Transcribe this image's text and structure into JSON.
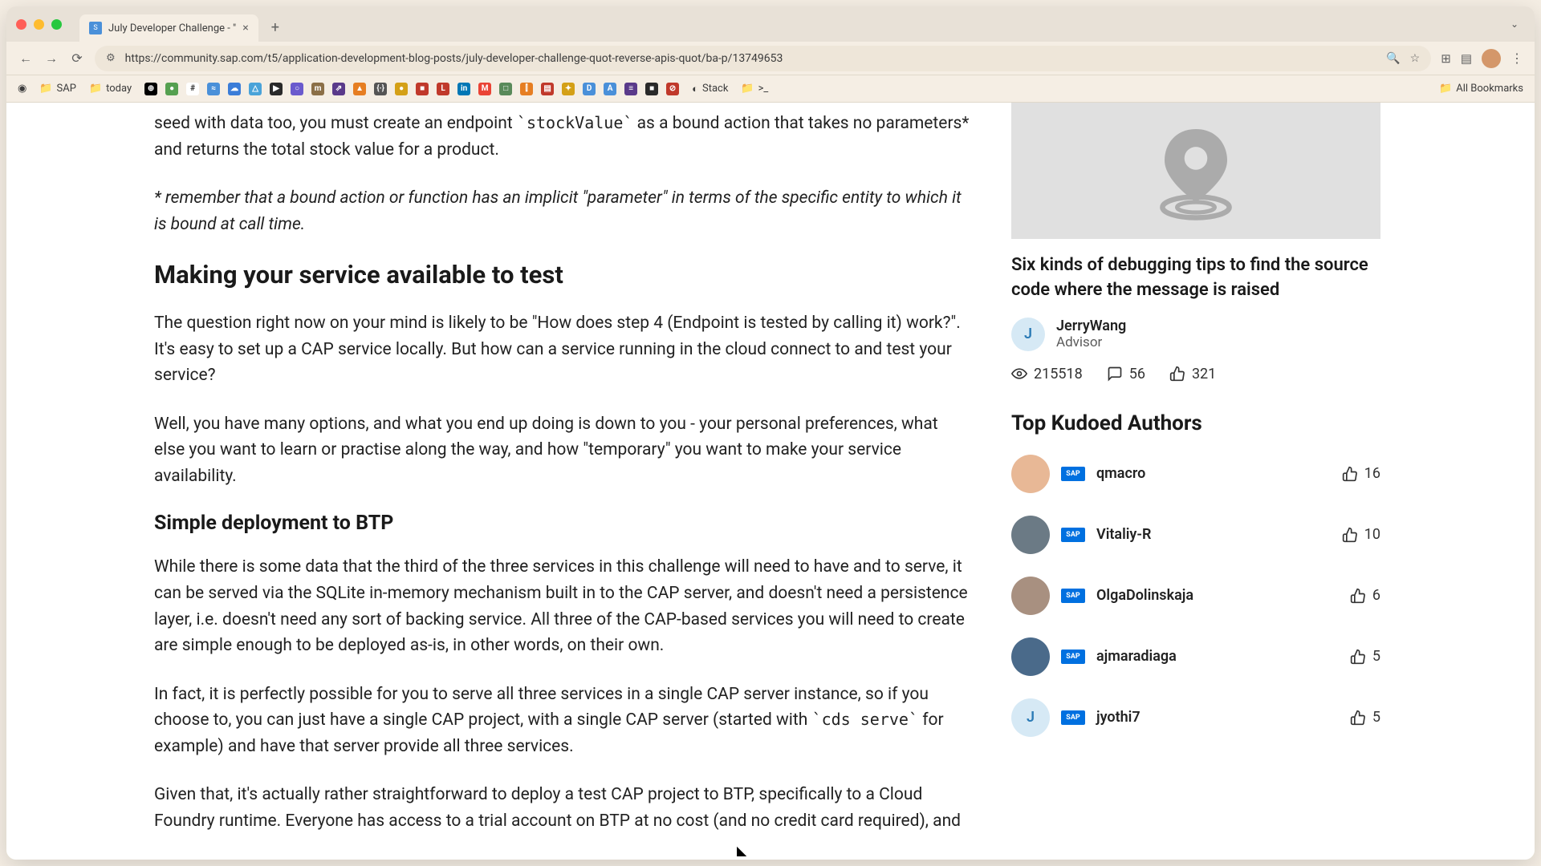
{
  "tab": {
    "title": "July Developer Challenge - \"",
    "favicon": "S"
  },
  "url": "https://community.sap.com/t5/application-development-blog-posts/july-developer-challenge-quot-reverse-apis-quot/ba-p/13749653",
  "bookmarks": {
    "items": [
      "SAP",
      "today"
    ],
    "right_label": "All Bookmarks",
    "stack_label": "Stack",
    "prompt_label": ">_"
  },
  "article": {
    "p1_prefix": "seed with data too, you must create an endpoint ",
    "p1_code": "`stockValue`",
    "p1_suffix": " as a bound action that takes no parameters* and returns the total stock value for a product.",
    "note": "* remember that a bound action or function has an implicit \"parameter\" in terms of the specific entity to which it is bound at call time.",
    "h2": "Making your service available to test",
    "p2": "The question right now on your mind is likely to be \"How does step 4 (Endpoint is tested by calling it) work?\". It's easy to set up a CAP service locally. But how can a service running in the cloud connect to and test your service?",
    "p3": "Well, you have many options, and what you end up doing is down to you - your personal preferences, what else you want to learn or practise along the way, and how \"temporary\" you want to make your service availability.",
    "h3": "Simple deployment to BTP",
    "p4": "While there is some data that the third of the three services in this challenge will need to have and to serve, it can be served via the SQLite in-memory mechanism built in to the CAP server, and doesn't need a persistence layer, i.e. doesn't need any sort of backing service. All three of the CAP-based services you will need to create are simple enough to be deployed as-is, in other words, on their own.",
    "p5_prefix": "In fact, it is perfectly possible for you to serve all three services in a single CAP server instance, so if you choose to, you can just have a single CAP project, with a single CAP server (started with ",
    "p5_code": "`cds serve`",
    "p5_suffix": " for example) and have that server provide all three services.",
    "p6": "Given that, it's actually rather straightforward to deploy a test CAP project to BTP, specifically to a Cloud Foundry runtime. Everyone has access to a trial account on BTP at no cost (and no credit card required), and"
  },
  "related": {
    "title": "Six kinds of debugging tips to find the source code where the message is raised",
    "author_initial": "J",
    "author_name": "JerryWang",
    "author_role": "Advisor",
    "views": "215518",
    "comments": "56",
    "likes": "321"
  },
  "kudoed": {
    "heading": "Top Kudoed Authors",
    "authors": [
      {
        "name": "qmacro",
        "kudos": "16",
        "avatar_bg": "#e8b896",
        "initial": ""
      },
      {
        "name": "Vitaliy-R",
        "kudos": "10",
        "avatar_bg": "#6b7a85",
        "initial": ""
      },
      {
        "name": "OlgaDolinskaja",
        "kudos": "6",
        "avatar_bg": "#a89080",
        "initial": ""
      },
      {
        "name": "ajmaradiaga",
        "kudos": "5",
        "avatar_bg": "#4a6a8a",
        "initial": ""
      },
      {
        "name": "jyothi7",
        "kudos": "5",
        "avatar_bg": "#d6e9f5",
        "initial": "J"
      }
    ]
  },
  "bm_icons": [
    {
      "bg": "#000",
      "fg": "#fff",
      "txt": "⊕"
    },
    {
      "bg": "#55a050",
      "fg": "#fff",
      "txt": "●"
    },
    {
      "bg": "#fff",
      "fg": "#333",
      "txt": "#"
    },
    {
      "bg": "#4a90d9",
      "fg": "#fff",
      "txt": "≈"
    },
    {
      "bg": "#3b7dd8",
      "fg": "#fff",
      "txt": "☁"
    },
    {
      "bg": "#4aa3d9",
      "fg": "#fff",
      "txt": "△"
    },
    {
      "bg": "#2a2a2a",
      "fg": "#fff",
      "txt": "▶"
    },
    {
      "bg": "#6a5acd",
      "fg": "#fff",
      "txt": "○"
    },
    {
      "bg": "#8b6f47",
      "fg": "#fff",
      "txt": "m"
    },
    {
      "bg": "#5a3a8a",
      "fg": "#fff",
      "txt": "⇗"
    },
    {
      "bg": "#e67e22",
      "fg": "#fff",
      "txt": "▲"
    },
    {
      "bg": "#555",
      "fg": "#fff",
      "txt": "{·}"
    },
    {
      "bg": "#d4a017",
      "fg": "#fff",
      "txt": "●"
    },
    {
      "bg": "#c0392b",
      "fg": "#fff",
      "txt": "■"
    },
    {
      "bg": "#c0392b",
      "fg": "#fff",
      "txt": "L"
    },
    {
      "bg": "#0077b5",
      "fg": "#fff",
      "txt": "in"
    },
    {
      "bg": "#ea4335",
      "fg": "#fff",
      "txt": "M"
    },
    {
      "bg": "#5a8a5a",
      "fg": "#fff",
      "txt": "□"
    },
    {
      "bg": "#e67e22",
      "fg": "#fff",
      "txt": "⫿"
    },
    {
      "bg": "#c0392b",
      "fg": "#fff",
      "txt": "▤"
    },
    {
      "bg": "#d4a017",
      "fg": "#fff",
      "txt": "✦"
    },
    {
      "bg": "#4a90d9",
      "fg": "#fff",
      "txt": "D"
    },
    {
      "bg": "#4a90d9",
      "fg": "#fff",
      "txt": "A"
    },
    {
      "bg": "#5a3a8a",
      "fg": "#fff",
      "txt": "≡"
    },
    {
      "bg": "#2a2a2a",
      "fg": "#fff",
      "txt": "■"
    },
    {
      "bg": "#c0392b",
      "fg": "#fff",
      "txt": "⊘"
    }
  ]
}
